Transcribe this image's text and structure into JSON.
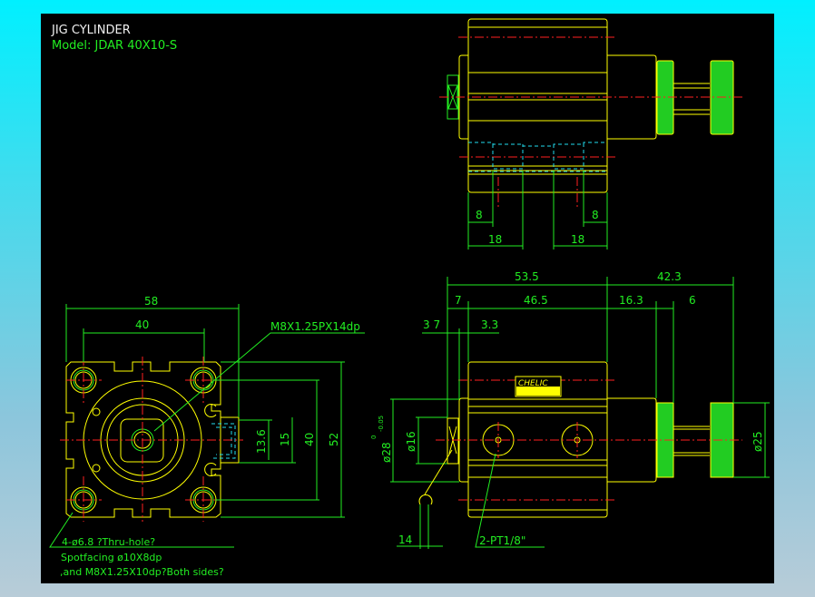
{
  "title": "JIG CYLINDER",
  "model": "Model:  JDAR  40X10-S",
  "colors": {
    "outline": "#ffff00",
    "dimension": "#22ee22",
    "centerline": "#ff2020",
    "hidden": "#22ddee",
    "background": "#000000"
  },
  "top_view": {
    "dims": [
      "8",
      "18",
      "8",
      "18"
    ]
  },
  "front_view": {
    "dims": {
      "overall_body": "53.5",
      "overall_rod": "42.3",
      "a": "7",
      "body": "46.5",
      "neck": "16.3",
      "knob": "6",
      "b": "3 7",
      "c": "3.3",
      "d28": "ø28",
      "d28_tol_upper": "0",
      "d28_tol_lower": "-0.05",
      "d16": "ø16",
      "d25": "ø25",
      "wrench": "14"
    },
    "port_note": "2-PT1/8\"",
    "brand": "CHELIC"
  },
  "side_view": {
    "dims": {
      "width": "58",
      "pitch": "40",
      "h1": "13.6",
      "h2": "15",
      "h3": "40",
      "h4": "52"
    },
    "thread_note": "M8X1.25PX14dp",
    "hole_note": [
      "4-ø6.8 ?Thru-hole?",
      "Spotfacing ø10X8dp",
      ",and M8X1.25X10dp?Both sides?"
    ]
  }
}
